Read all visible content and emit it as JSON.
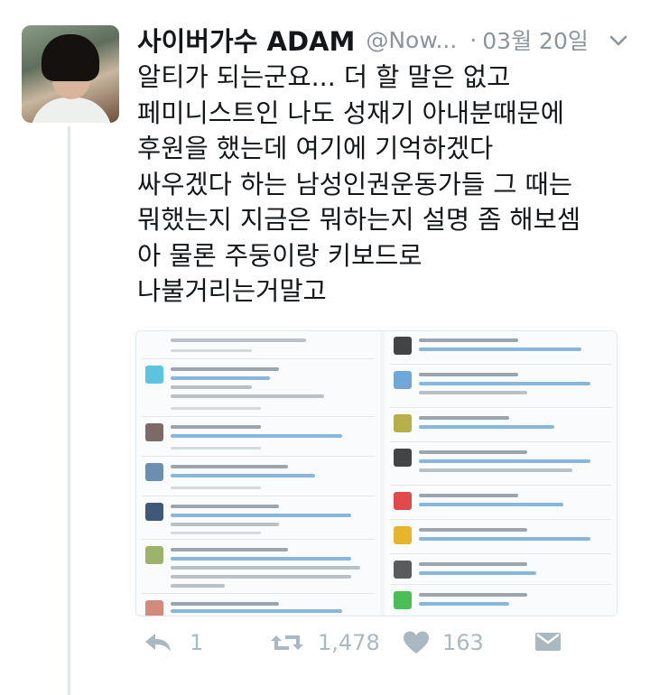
{
  "tweet": {
    "display_name": "사이버가수 ADAM",
    "handle": "@Now...",
    "separator": "·",
    "date": "03월 20일",
    "lines": [
      "알티가 되는군요... 더 할 말은 없고",
      "페미니스트인 나도 성재기 아내분때문에",
      "후원을 했는데 여기에 기억하겠다",
      "싸우겠다 하는 남성인권운동가들 그 때는",
      "뭐했는지 지금은 뭐하는지 설명 좀 해보셈",
      "아 물론 주둥이랑 키보드로",
      "나불거리는거말고"
    ]
  },
  "actions": {
    "reply_count": "1",
    "retweet_count": "1,478",
    "like_count": "163"
  },
  "colors": {
    "text": "#14171a",
    "meta": "#8a959e",
    "action_icon": "#aab8c2",
    "thread_line": "#e1e8ed",
    "link_blue": "#1da1f2"
  },
  "icons": [
    "chevron-down-icon",
    "reply-icon",
    "retweet-icon",
    "heart-icon",
    "message-icon"
  ]
}
